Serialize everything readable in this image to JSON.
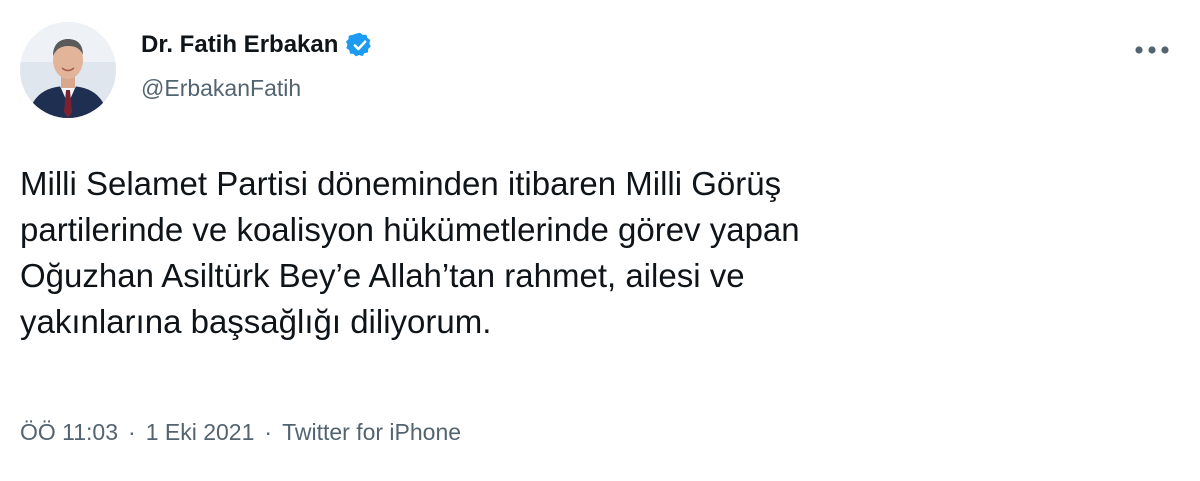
{
  "author": {
    "display_name": "Dr. Fatih Erbakan",
    "handle": "@ErbakanFatih",
    "verified": true,
    "avatar_icon": "profile-photo"
  },
  "tweet": {
    "text": "Milli Selamet Partisi döneminden itibaren Milli Görüş\npartilerinde ve koalisyon hükümetlerinde görev yapan\nOğuzhan Asiltürk Bey’e Allah’tan rahmet, ailesi ve\nyakınlarına başsağlığı diliyorum."
  },
  "meta": {
    "time": "ÖÖ 11:03",
    "separator": "·",
    "date": "1 Eki 2021",
    "source": "Twitter for iPhone"
  },
  "icons": {
    "verified": "verified-badge-icon",
    "more": "more-options-icon"
  },
  "colors": {
    "text_primary": "#0f1419",
    "text_secondary": "#536471",
    "verified_blue": "#1d9bf0",
    "background": "#ffffff"
  }
}
